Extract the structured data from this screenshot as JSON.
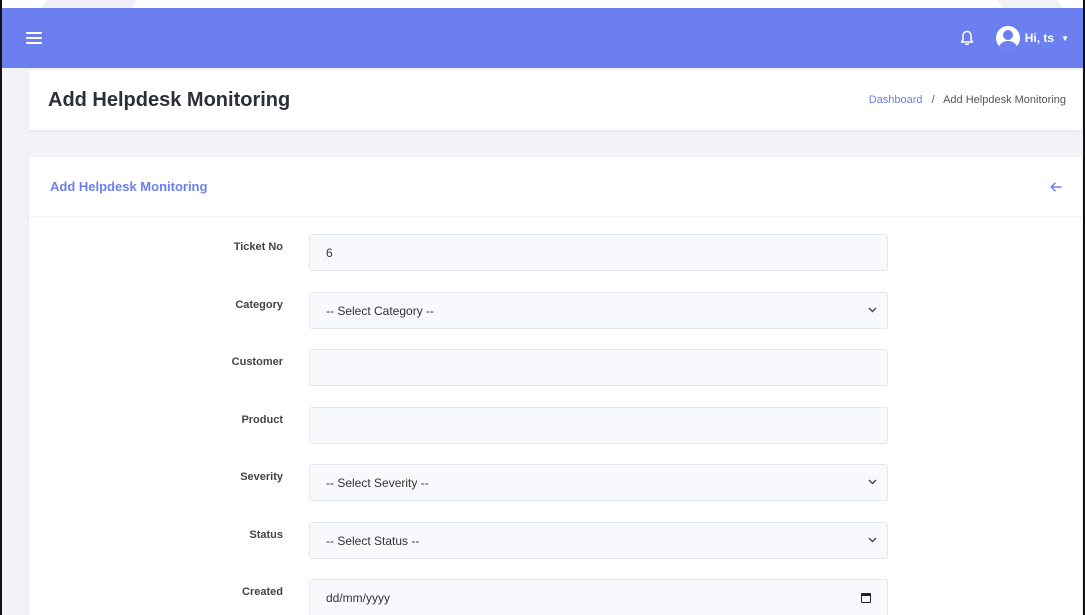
{
  "topbar": {
    "user_greeting": "Hi, ts",
    "accent_color": "#6c7ff0",
    "menu_icon": "hamburger-menu-icon",
    "notification_icon": "bell-icon",
    "user_icon": "user-avatar-icon"
  },
  "header": {
    "title": "Add Helpdesk Monitoring",
    "breadcrumb": {
      "home": "Dashboard",
      "separator": "/",
      "current": "Add Helpdesk Monitoring"
    }
  },
  "form": {
    "title": "Add Helpdesk Monitoring",
    "back_icon": "arrow-left-icon",
    "fields": {
      "ticket_no": {
        "label": "Ticket No",
        "value": "6"
      },
      "category": {
        "label": "Category",
        "selected": "-- Select Category --"
      },
      "customer": {
        "label": "Customer",
        "value": ""
      },
      "product": {
        "label": "Product",
        "value": ""
      },
      "severity": {
        "label": "Severity",
        "selected": "-- Select Severity --"
      },
      "status": {
        "label": "Status",
        "selected": "-- Select Status --"
      },
      "created": {
        "label": "Created",
        "placeholder": "dd/mm/yyyy"
      }
    }
  }
}
